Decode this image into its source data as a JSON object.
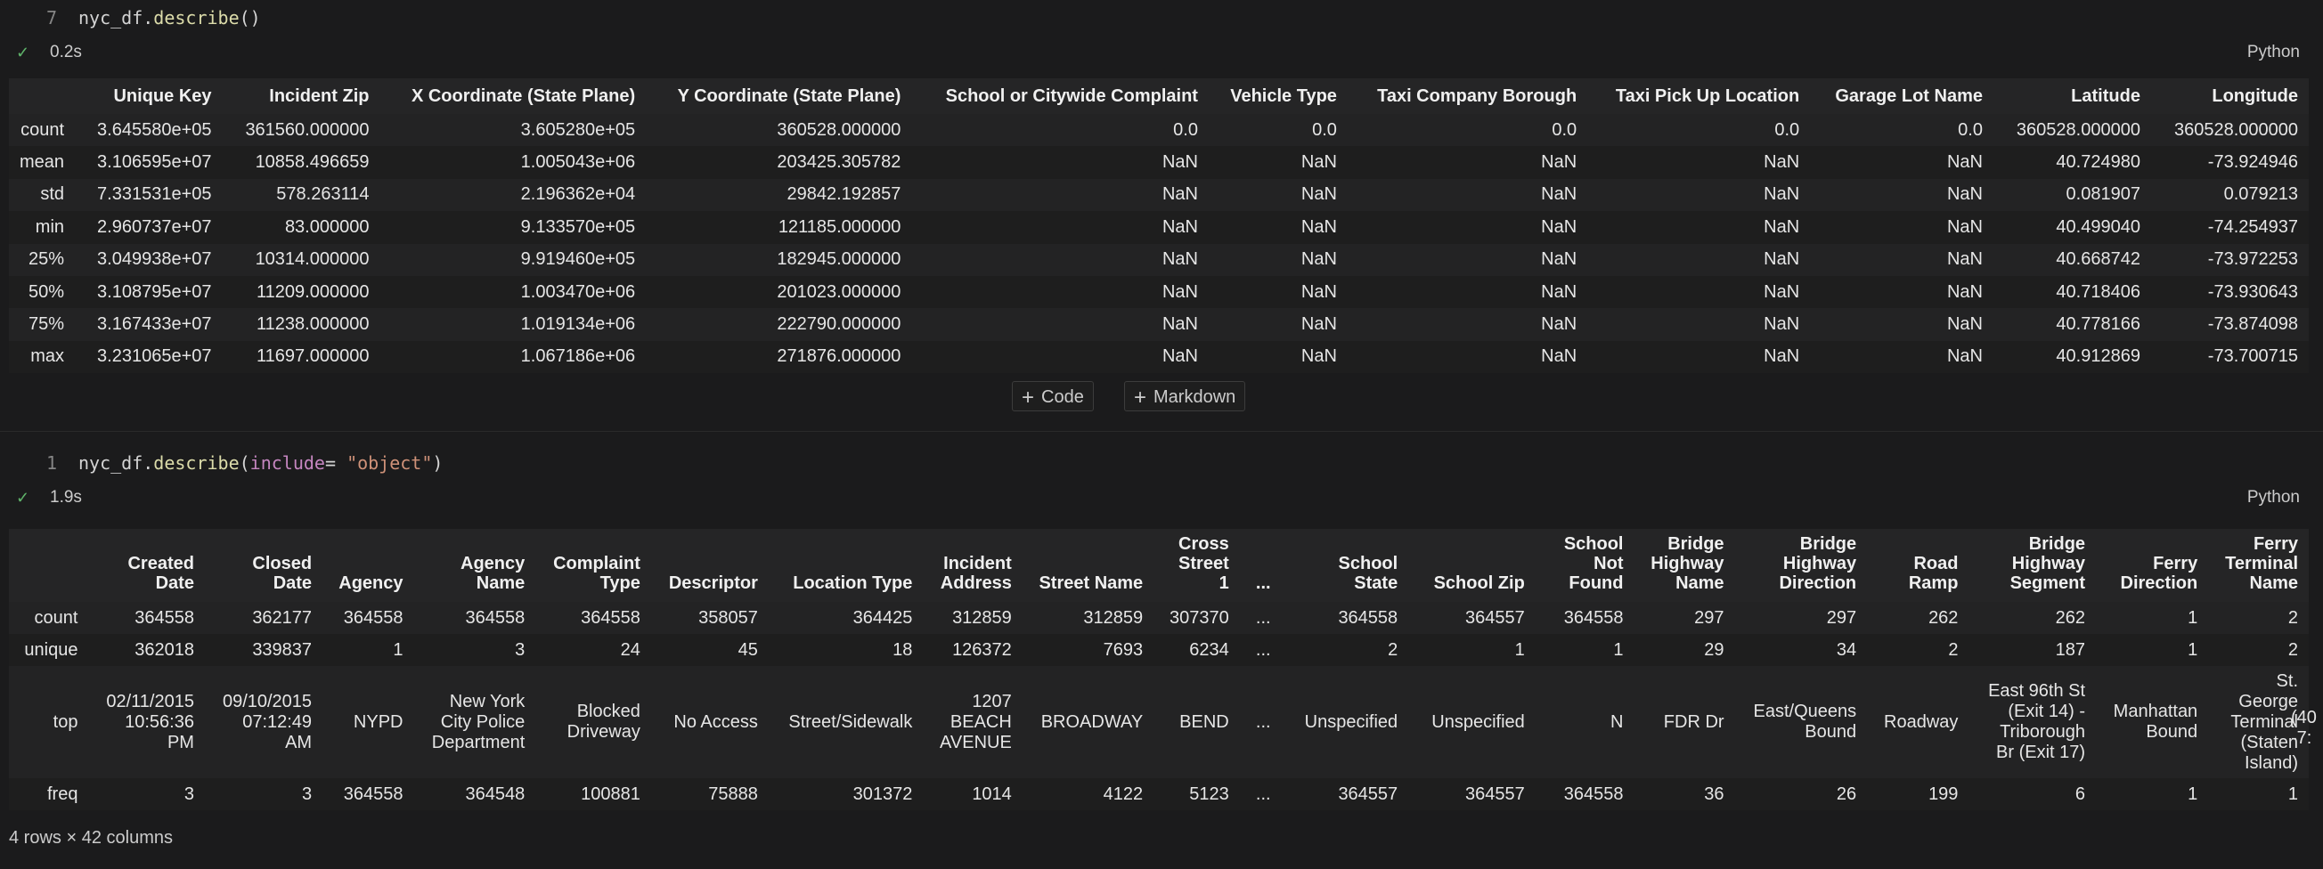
{
  "cell1": {
    "line_number": "7",
    "code_prefix": "nyc_df.",
    "code_fn": "describe",
    "code_suffix": "()",
    "exec_time": "0.2s",
    "language": "Python",
    "columns": [
      "",
      "Unique Key",
      "Incident Zip",
      "X Coordinate (State Plane)",
      "Y Coordinate (State Plane)",
      "School or Citywide Complaint",
      "Vehicle Type",
      "Taxi Company Borough",
      "Taxi Pick Up Location",
      "Garage Lot Name",
      "Latitude",
      "Longitude"
    ],
    "rows": [
      [
        "count",
        "3.645580e+05",
        "361560.000000",
        "3.605280e+05",
        "360528.000000",
        "0.0",
        "0.0",
        "0.0",
        "0.0",
        "0.0",
        "360528.000000",
        "360528.000000"
      ],
      [
        "mean",
        "3.106595e+07",
        "10858.496659",
        "1.005043e+06",
        "203425.305782",
        "NaN",
        "NaN",
        "NaN",
        "NaN",
        "NaN",
        "40.724980",
        "-73.924946"
      ],
      [
        "std",
        "7.331531e+05",
        "578.263114",
        "2.196362e+04",
        "29842.192857",
        "NaN",
        "NaN",
        "NaN",
        "NaN",
        "NaN",
        "0.081907",
        "0.079213"
      ],
      [
        "min",
        "2.960737e+07",
        "83.000000",
        "9.133570e+05",
        "121185.000000",
        "NaN",
        "NaN",
        "NaN",
        "NaN",
        "NaN",
        "40.499040",
        "-74.254937"
      ],
      [
        "25%",
        "3.049938e+07",
        "10314.000000",
        "9.919460e+05",
        "182945.000000",
        "NaN",
        "NaN",
        "NaN",
        "NaN",
        "NaN",
        "40.668742",
        "-73.972253"
      ],
      [
        "50%",
        "3.108795e+07",
        "11209.000000",
        "1.003470e+06",
        "201023.000000",
        "NaN",
        "NaN",
        "NaN",
        "NaN",
        "NaN",
        "40.718406",
        "-73.930643"
      ],
      [
        "75%",
        "3.167433e+07",
        "11238.000000",
        "1.019134e+06",
        "222790.000000",
        "NaN",
        "NaN",
        "NaN",
        "NaN",
        "NaN",
        "40.778166",
        "-73.874098"
      ],
      [
        "max",
        "3.231065e+07",
        "11697.000000",
        "1.067186e+06",
        "271876.000000",
        "NaN",
        "NaN",
        "NaN",
        "NaN",
        "NaN",
        "40.912869",
        "-73.700715"
      ]
    ]
  },
  "toolbar": {
    "add_code_label": "Code",
    "add_markdown_label": "Markdown"
  },
  "cell2": {
    "line_number": "1",
    "code_prefix": "nyc_df.",
    "code_fn": "describe",
    "code_open": "(",
    "code_kw": "include",
    "code_eq": "= ",
    "code_str": "\"object\"",
    "code_close": ")",
    "exec_time": "1.9s",
    "language": "Python",
    "columns": [
      "",
      "Created Date",
      "Closed Date",
      "Agency",
      "Agency Name",
      "Complaint Type",
      "Descriptor",
      "Location Type",
      "Incident Address",
      "Street Name",
      "Cross Street 1",
      "...",
      "School State",
      "School Zip",
      "School Not Found",
      "Bridge Highway Name",
      "Bridge Highway Direction",
      "Road Ramp",
      "Bridge Highway Segment",
      "Ferry Direction",
      "Ferry Terminal Name"
    ],
    "rows": [
      [
        "count",
        "364558",
        "362177",
        "364558",
        "364558",
        "364558",
        "358057",
        "364425",
        "312859",
        "312859",
        "307370",
        "...",
        "364558",
        "364557",
        "364558",
        "297",
        "297",
        "262",
        "262",
        "1",
        "2"
      ],
      [
        "unique",
        "362018",
        "339837",
        "1",
        "3",
        "24",
        "45",
        "18",
        "126372",
        "7693",
        "6234",
        "...",
        "2",
        "1",
        "1",
        "29",
        "34",
        "2",
        "187",
        "1",
        "2"
      ],
      [
        "top",
        "02/11/2015 10:56:36 PM",
        "09/10/2015 07:12:49 AM",
        "NYPD",
        "New York City Police Department",
        "Blocked Driveway",
        "No Access",
        "Street/Sidewalk",
        "1207 BEACH AVENUE",
        "BROADWAY",
        "BEND",
        "...",
        "Unspecified",
        "Unspecified",
        "N",
        "FDR Dr",
        "East/Queens Bound",
        "Roadway",
        "East 96th St (Exit 14) - Triborough Br (Exit 17)",
        "Manhattan Bound",
        "St. George Terminal (Staten Island)"
      ],
      [
        "freq",
        "3",
        "3",
        "364558",
        "364548",
        "100881",
        "75888",
        "301372",
        "1014",
        "4122",
        "5123",
        "...",
        "364557",
        "364557",
        "364558",
        "36",
        "26",
        "199",
        "6",
        "1",
        "1"
      ]
    ],
    "overflow_fragment_1": "(40",
    "overflow_fragment_2": "-7:",
    "footer": "4 rows × 42 columns"
  }
}
